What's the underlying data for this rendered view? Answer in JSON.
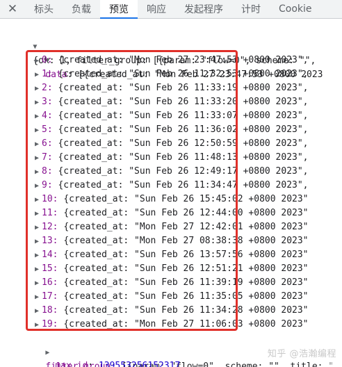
{
  "tabs": {
    "items": [
      {
        "label": "标头"
      },
      {
        "label": "负载"
      },
      {
        "label": "预览"
      },
      {
        "label": "响应"
      },
      {
        "label": "发起程序"
      },
      {
        "label": "计时"
      },
      {
        "label": "Cookie"
      }
    ],
    "active": "预览"
  },
  "preview": {
    "root_summary": "{ok: 1, filter_group: [{param: \"flow=0\", scheme: \"\",",
    "data_summary": "[{created_at: \"Mon Feb 27 23:47:53 +0800 2023",
    "data_key": "data",
    "items": [
      {
        "index": "0:",
        "text": "{created_at: \"Mon Feb 27 23:47:53 +0800 2023\","
      },
      {
        "index": "1:",
        "text": "{created_at: \"Sun Feb 26 11:32:53 +0800 2023\","
      },
      {
        "index": "2:",
        "text": "{created_at: \"Sun Feb 26 11:33:19 +0800 2023\","
      },
      {
        "index": "3:",
        "text": "{created_at: \"Sun Feb 26 11:33:20 +0800 2023\","
      },
      {
        "index": "4:",
        "text": "{created_at: \"Sun Feb 26 11:33:07 +0800 2023\","
      },
      {
        "index": "5:",
        "text": "{created_at: \"Sun Feb 26 11:36:02 +0800 2023\","
      },
      {
        "index": "6:",
        "text": "{created_at: \"Sun Feb 26 12:50:59 +0800 2023\","
      },
      {
        "index": "7:",
        "text": "{created_at: \"Sun Feb 26 11:48:13 +0800 2023\","
      },
      {
        "index": "8:",
        "text": "{created_at: \"Sun Feb 26 12:49:17 +0800 2023\","
      },
      {
        "index": "9:",
        "text": "{created_at: \"Sun Feb 26 11:34:47 +0800 2023\","
      },
      {
        "index": "10:",
        "text": "{created_at: \"Sun Feb 26 15:45:02 +0800 2023\""
      },
      {
        "index": "11:",
        "text": "{created_at: \"Sun Feb 26 12:44:00 +0800 2023\""
      },
      {
        "index": "12:",
        "text": "{created_at: \"Mon Feb 27 12:42:01 +0800 2023\""
      },
      {
        "index": "13:",
        "text": "{created_at: \"Mon Feb 27 08:38:38 +0800 2023\""
      },
      {
        "index": "14:",
        "text": "{created_at: \"Sun Feb 26 13:57:56 +0800 2023\""
      },
      {
        "index": "15:",
        "text": "{created_at: \"Sun Feb 26 12:51:21 +0800 2023\""
      },
      {
        "index": "16:",
        "text": "{created_at: \"Sun Feb 26 11:39:19 +0800 2023\""
      },
      {
        "index": "17:",
        "text": "{created_at: \"Sun Feb 26 11:35:05 +0800 2023\""
      },
      {
        "index": "18:",
        "text": "{created_at: \"Sun Feb 26 11:34:28 +0800 2023\""
      },
      {
        "index": "19:",
        "text": "{created_at: \"Mon Feb 27 11:06:03 +0800 2023\""
      }
    ],
    "filter_group_key": "filter_group",
    "filter_group_value": "[{param: \"flow=0\", scheme: \"\", title: \"",
    "max_id_key": "max_id",
    "max_id_value": "139553256152317",
    "ok_key": "ok",
    "ok_value": "1"
  },
  "watermark": "知乎 @浩瀚编程",
  "colors": {
    "highlight_border": "#e0302a",
    "active_tab_underline": "#1a73e8",
    "key": "#881391",
    "number": "#1c00cf"
  }
}
